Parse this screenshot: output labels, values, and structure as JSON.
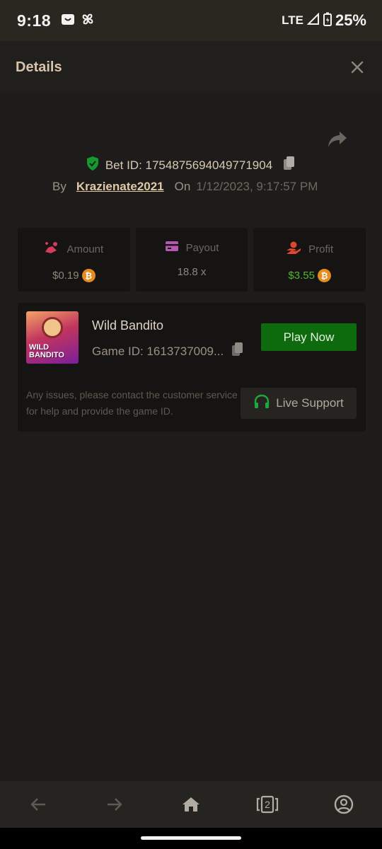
{
  "status_bar": {
    "time": "9:18",
    "network": "LTE",
    "battery": "25%"
  },
  "header": {
    "title": "Details"
  },
  "bet": {
    "id_label": "Bet ID: 1754875694049771904",
    "by_label": "By",
    "username": "Krazienate2021",
    "on_label": "On",
    "date": "1/12/2023, 9:17:57 PM"
  },
  "stats": {
    "amount": {
      "label": "Amount",
      "value": "$0.19"
    },
    "payout": {
      "label": "Payout",
      "value": "18.8 x"
    },
    "profit": {
      "label": "Profit",
      "value": "$3.55"
    }
  },
  "game": {
    "name": "Wild Bandito",
    "thumb_text": "WILD BANDITO",
    "id_label": "Game ID: 1613737009...",
    "play_label": "Play Now",
    "notice": "Any issues, please contact the customer service for help and provide the game ID.",
    "support_label": "Live Support"
  },
  "bottom_nav": {
    "tabs_count": "2"
  },
  "colors": {
    "accent_green": "#0d6b0d",
    "profit_green": "#55b436",
    "coin_orange": "#e88b1e",
    "username": "#e1c8a8"
  },
  "icons": [
    "notification-bag-icon",
    "pinwheel-icon",
    "signal-icon",
    "battery-icon",
    "close-icon",
    "share-icon",
    "shield-check-icon",
    "copy-icon",
    "amount-icon",
    "payout-card-icon",
    "profit-hand-icon",
    "coin-icon",
    "headset-icon",
    "back-arrow-icon",
    "forward-arrow-icon",
    "home-icon",
    "tabs-icon",
    "account-icon"
  ]
}
